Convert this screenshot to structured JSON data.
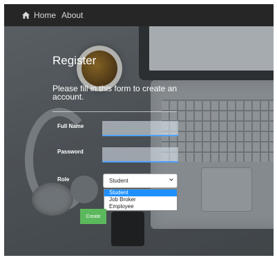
{
  "navbar": {
    "home_icon": "home-icon",
    "home_label": "Home",
    "about_label": "About"
  },
  "form": {
    "title": "Register",
    "subtitle": "Please fill in this form to create an account.",
    "full_name_label": "Full Name",
    "full_name_value": "",
    "password_label": "Password",
    "password_value": "",
    "role_label": "Role",
    "role_selected": "Student",
    "role_options": [
      "Student",
      "Job Broker",
      "Employee"
    ],
    "highlighted_option": "Student",
    "create_label": "Create"
  },
  "colors": {
    "navbar_bg": "#262626",
    "input_underline": "#4ea3ff",
    "option_highlight": "#1e90ff",
    "create_button": "#5cb85c"
  }
}
